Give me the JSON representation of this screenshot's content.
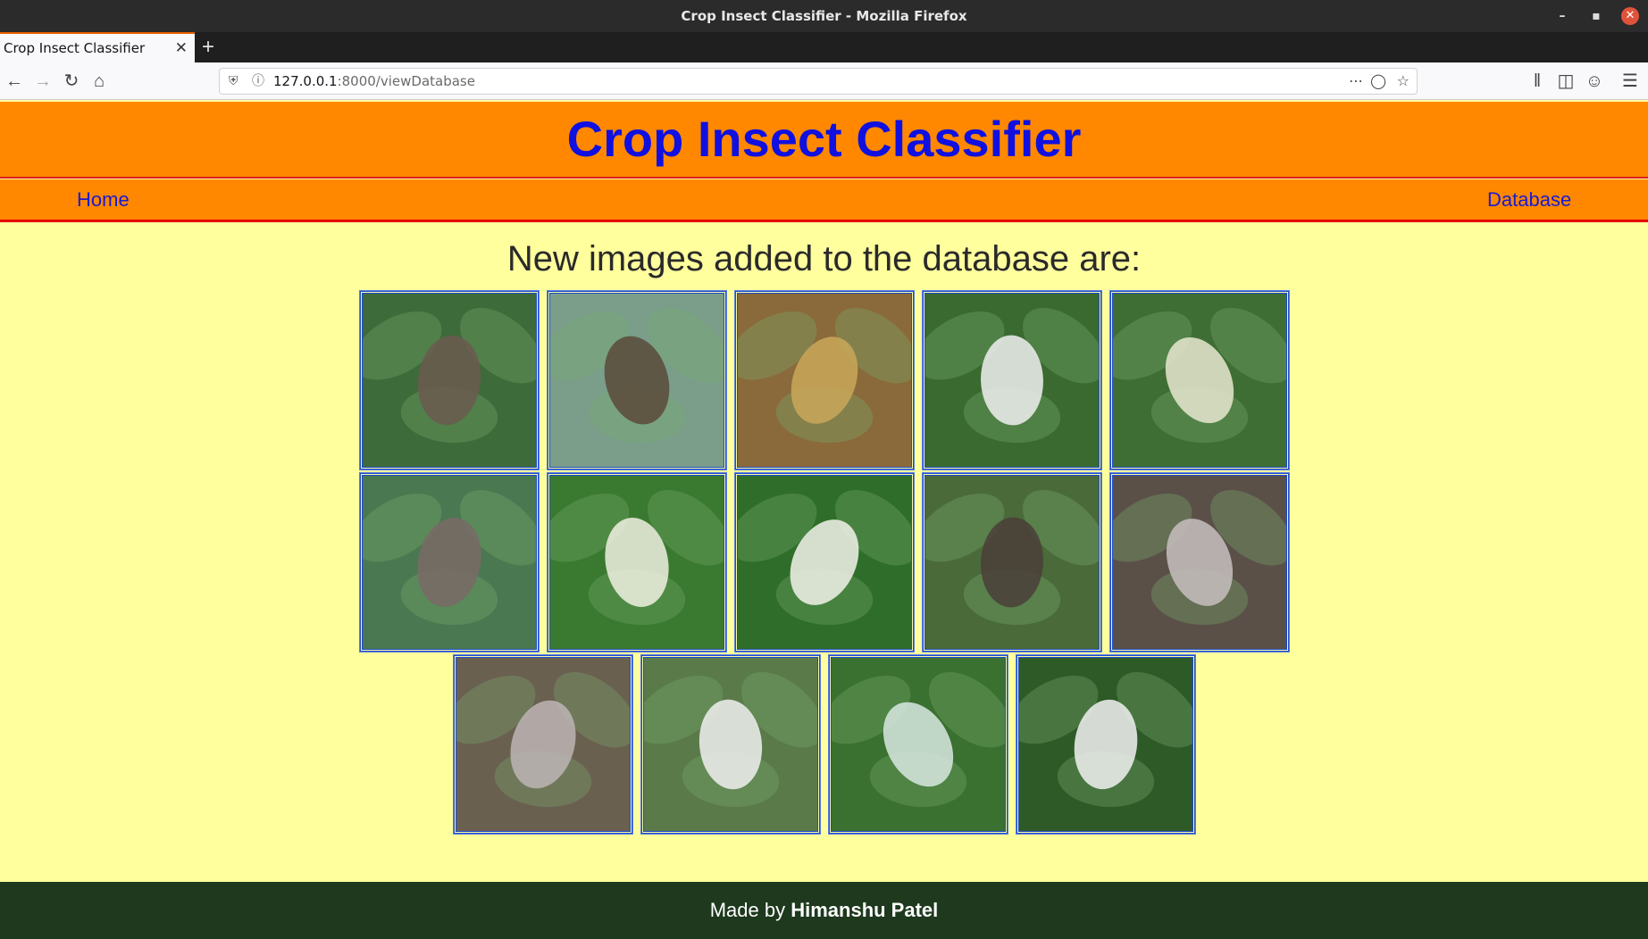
{
  "window": {
    "title": "Crop Insect Classifier - Mozilla Firefox"
  },
  "browser": {
    "tab_title": "Crop Insect Classifier",
    "url_host": "127.0.0.1",
    "url_rest": ":8000/viewDatabase"
  },
  "page": {
    "site_title": "Crop Insect Classifier",
    "nav": {
      "home": "Home",
      "database": "Database"
    },
    "heading": "New images added to the database are:",
    "images": [
      {
        "name": "stink-bug-on-leaf",
        "bg": "#3d6b3a",
        "fg": "#6b5a50"
      },
      {
        "name": "damaged-leaves",
        "bg": "#7a9e8a",
        "fg": "#5a4a3a"
      },
      {
        "name": "pods-with-bug",
        "bg": "#8a6a3a",
        "fg": "#c9a85a"
      },
      {
        "name": "white-moth",
        "bg": "#3a6a30",
        "fg": "#f0f0f0"
      },
      {
        "name": "caterpillar-on-plant",
        "bg": "#3e6e34",
        "fg": "#e8e8d0"
      },
      {
        "name": "stink-bug-closeup",
        "bg": "#4a7850",
        "fg": "#7a6a66"
      },
      {
        "name": "caterpillar-leaf",
        "bg": "#3a7a30",
        "fg": "#f0f0e0"
      },
      {
        "name": "white-caterpillar",
        "bg": "#2f6e2a",
        "fg": "#f3f3ea"
      },
      {
        "name": "bug-on-pod",
        "bg": "#4a6a3a",
        "fg": "#4a3e38"
      },
      {
        "name": "blurred-bug",
        "bg": "#5a5048",
        "fg": "#c8c0c0"
      },
      {
        "name": "blurred-bug-2",
        "bg": "#6a6050",
        "fg": "#bdb5b5"
      },
      {
        "name": "leaves-with-holes",
        "bg": "#5a7a4a",
        "fg": "#f0f0f0"
      },
      {
        "name": "caterpillar-closeup",
        "bg": "#3a7030",
        "fg": "#d8e8e0"
      },
      {
        "name": "white-moth-2",
        "bg": "#2e5a28",
        "fg": "#f2f2f2"
      }
    ],
    "footer_prefix": "Made by ",
    "footer_name": "Himanshu Patel"
  },
  "colors": {
    "header_bg": "#ff8800",
    "title_color": "#1010e0",
    "page_bg": "#ffff9e",
    "footer_bg": "#1e391e"
  }
}
